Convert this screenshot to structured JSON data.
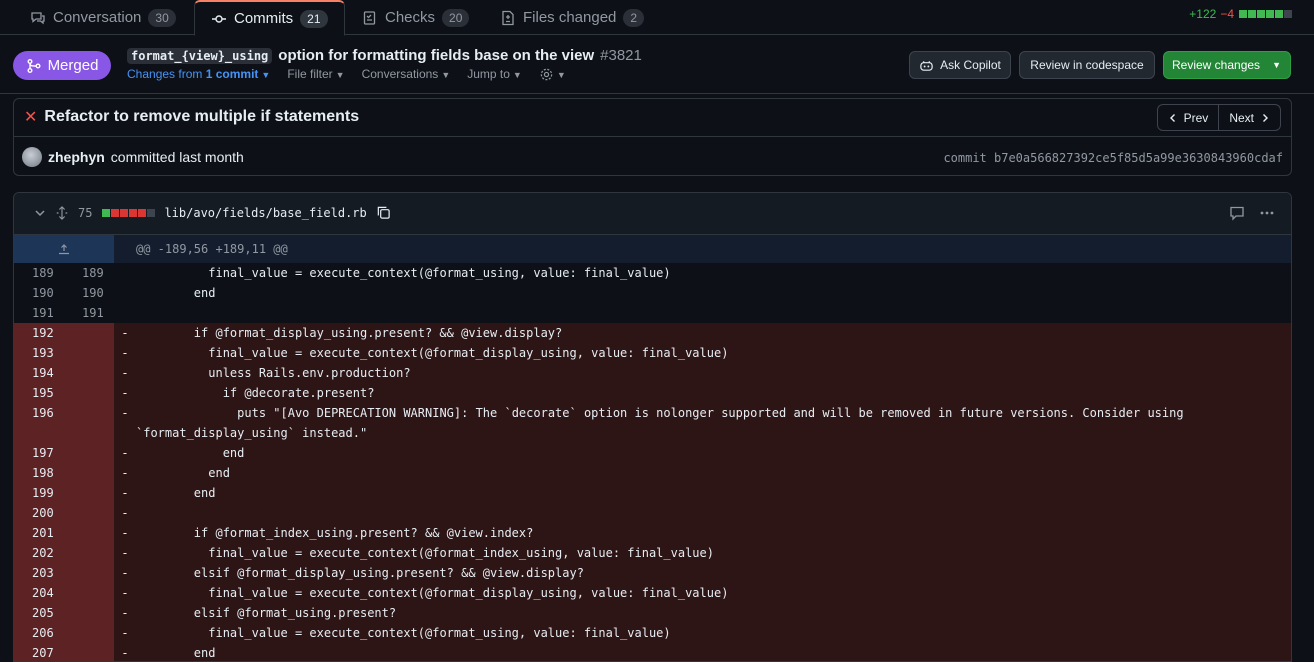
{
  "tabs": [
    {
      "label": "Conversation",
      "count": "30"
    },
    {
      "label": "Commits",
      "count": "21"
    },
    {
      "label": "Checks",
      "count": "20"
    },
    {
      "label": "Files changed",
      "count": "2"
    }
  ],
  "diffstat": {
    "additions": "+122",
    "deletions": "−4"
  },
  "header": {
    "state": "Merged",
    "title_code": "format_{view}_using",
    "title_text": "option for formatting fields base on the view",
    "number": "#3821",
    "changes_from": "Changes from",
    "changes_link": "1 commit",
    "file_filter": "File filter",
    "conversations": "Conversations",
    "jump_to": "Jump to",
    "ask_copilot": "Ask Copilot",
    "review_codespace": "Review in codespace",
    "review_changes": "Review changes"
  },
  "commit": {
    "title": "Refactor to remove multiple if statements",
    "prev": "Prev",
    "next": "Next",
    "author": "zhephyn",
    "action": "committed last month",
    "sha_label": "commit b7e0a566827392ce5f85d5a99e3630843960cdaf"
  },
  "file": {
    "changes": "75",
    "path": "lib/avo/fields/base_field.rb",
    "hunk": "@@ -189,56 +189,11 @@"
  },
  "colors": {
    "merged": "#8957e5",
    "green": "#238636",
    "deletion_bg": "#2d1516"
  },
  "lines": [
    {
      "type": "ctx",
      "old": "189",
      "new": "189",
      "sign": "",
      "code": "          final_value = execute_context(@format_using, value: final_value)"
    },
    {
      "type": "ctx",
      "old": "190",
      "new": "190",
      "sign": "",
      "code": "        end"
    },
    {
      "type": "ctx",
      "old": "191",
      "new": "191",
      "sign": "",
      "code": ""
    },
    {
      "type": "del",
      "old": "192",
      "new": "",
      "sign": "-",
      "code": "        if @format_display_using.present? && @view.display?"
    },
    {
      "type": "del",
      "old": "193",
      "new": "",
      "sign": "-",
      "code": "          final_value = execute_context(@format_display_using, value: final_value)"
    },
    {
      "type": "del",
      "old": "194",
      "new": "",
      "sign": "-",
      "code": "          unless Rails.env.production?"
    },
    {
      "type": "del",
      "old": "195",
      "new": "",
      "sign": "-",
      "code": "            if @decorate.present?"
    },
    {
      "type": "del",
      "old": "196",
      "new": "",
      "sign": "-",
      "code": "              puts \"[Avo DEPRECATION WARNING]: The `decorate` option is nolonger supported and will be removed in future versions. Consider using `format_display_using` instead.\""
    },
    {
      "type": "del",
      "old": "197",
      "new": "",
      "sign": "-",
      "code": "            end"
    },
    {
      "type": "del",
      "old": "198",
      "new": "",
      "sign": "-",
      "code": "          end"
    },
    {
      "type": "del",
      "old": "199",
      "new": "",
      "sign": "-",
      "code": "        end"
    },
    {
      "type": "del",
      "old": "200",
      "new": "",
      "sign": "-",
      "code": ""
    },
    {
      "type": "del",
      "old": "201",
      "new": "",
      "sign": "-",
      "code": "        if @format_index_using.present? && @view.index?"
    },
    {
      "type": "del",
      "old": "202",
      "new": "",
      "sign": "-",
      "code": "          final_value = execute_context(@format_index_using, value: final_value)"
    },
    {
      "type": "del",
      "old": "203",
      "new": "",
      "sign": "-",
      "code": "        elsif @format_display_using.present? && @view.display?"
    },
    {
      "type": "del",
      "old": "204",
      "new": "",
      "sign": "-",
      "code": "          final_value = execute_context(@format_display_using, value: final_value)"
    },
    {
      "type": "del",
      "old": "205",
      "new": "",
      "sign": "-",
      "code": "        elsif @format_using.present?"
    },
    {
      "type": "del",
      "old": "206",
      "new": "",
      "sign": "-",
      "code": "          final_value = execute_context(@format_using, value: final_value)"
    },
    {
      "type": "del",
      "old": "207",
      "new": "",
      "sign": "-",
      "code": "        end"
    }
  ]
}
